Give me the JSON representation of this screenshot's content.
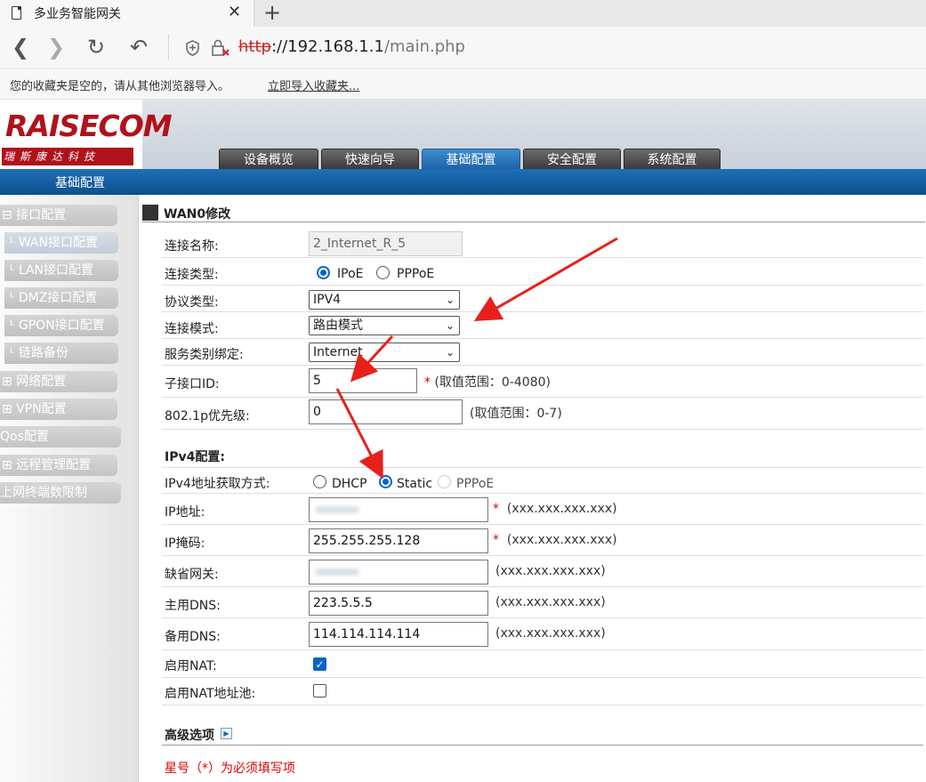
{
  "browser": {
    "tab_title": "多业务智能网关",
    "url_scheme": "http",
    "url_host": "://192.168.1.1",
    "url_path": "/main.php",
    "fav_text": "您的收藏夹是空的，请从其他浏览器导入。",
    "fav_link": "立即导入收藏夹..."
  },
  "header": {
    "logo": "RAISECOM",
    "logo_sub": "瑞斯康达科技",
    "tabs": [
      "设备概览",
      "快速向导",
      "基础配置",
      "安全配置",
      "系统配置"
    ],
    "active_tab": "基础配置",
    "section": "基础配置"
  },
  "sidebar": {
    "items": [
      {
        "label": "⊟ 接口配置"
      },
      {
        "label": "ᒻ WAN接口配置"
      },
      {
        "label": "ᒻ LAN接口配置"
      },
      {
        "label": "ᒻ DMZ接口配置"
      },
      {
        "label": "ᒻ GPON接口配置"
      },
      {
        "label": "ᒻ 链路备份"
      },
      {
        "label": "⊞  网络配置"
      },
      {
        "label": "⊞  VPN配置"
      },
      {
        "label": "Qos配置"
      },
      {
        "label": "⊞  远程管理配置"
      },
      {
        "label": "上网终端数限制"
      }
    ]
  },
  "form": {
    "title": "WAN0修改",
    "conn_name_label": "连接名称:",
    "conn_name_value": "2_Internet_R_5",
    "conn_type_label": "连接类型:",
    "conn_type_ipoe": "IPoE",
    "conn_type_pppoe": "PPPoE",
    "protocol_label": "协议类型:",
    "protocol_value": "IPV4",
    "mode_label": "连接模式:",
    "mode_value": "路由模式",
    "service_label": "服务类别绑定:",
    "service_value": "Internet",
    "subif_label": "子接口ID:",
    "subif_value": "5",
    "subif_hint": "(取值范围：0-4080)",
    "prio_label": "802.1p优先级:",
    "prio_value": "0",
    "prio_hint": "(取值范围：0-7)",
    "ipv4_title": "IPv4配置:",
    "ipv4_method_label": "IPv4地址获取方式:",
    "method_dhcp": "DHCP",
    "method_static": "Static",
    "method_pppoe": "PPPoE",
    "ip_label": "IP地址:",
    "ip_hint": "(xxx.xxx.xxx.xxx)",
    "mask_label": "IP掩码:",
    "mask_value": "255.255.255.128",
    "mask_hint": "(xxx.xxx.xxx.xxx)",
    "gw_label": "缺省网关:",
    "gw_hint": "(xxx.xxx.xxx.xxx)",
    "dns1_label": "主用DNS:",
    "dns1_value": "223.5.5.5",
    "dns1_hint": "(xxx.xxx.xxx.xxx)",
    "dns2_label": "备用DNS:",
    "dns2_value": "114.114.114.114",
    "dns2_hint": "(xxx.xxx.xxx.xxx)",
    "nat_label": "启用NAT:",
    "natpool_label": "启用NAT地址池:",
    "advanced_label": "高级选项",
    "required_note": "星号（*）为必须填写项"
  },
  "colors": {
    "accent_blue": "#1d63a8",
    "logo_red": "#b0121b",
    "arrow_red": "#e8201c"
  }
}
